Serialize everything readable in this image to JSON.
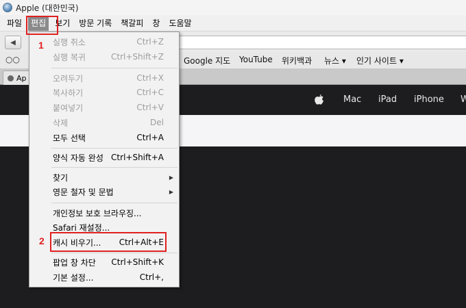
{
  "window": {
    "title": "Apple (대한민국)"
  },
  "menubar": {
    "items": [
      "파일",
      "편집",
      "보기",
      "방문 기록",
      "책갈피",
      "창",
      "도움말"
    ],
    "active": "편집"
  },
  "bookmarks": {
    "items": [
      "Google 지도",
      "YouTube",
      "위키백과",
      "뉴스 ▾",
      "인기 사이트 ▾"
    ]
  },
  "tab": {
    "label": "Ap"
  },
  "page": {
    "nav_links": [
      "Mac",
      "iPad",
      "iPhone",
      "W"
    ]
  },
  "annotations": {
    "step1": "1",
    "step2": "2",
    "color": "#e02020"
  },
  "edit_menu": {
    "undo": {
      "label": "실행 취소",
      "shortcut": "Ctrl+Z"
    },
    "redo": {
      "label": "실행 복귀",
      "shortcut": "Ctrl+Shift+Z"
    },
    "cut": {
      "label": "오려두기",
      "shortcut": "Ctrl+X"
    },
    "copy": {
      "label": "복사하기",
      "shortcut": "Ctrl+C"
    },
    "paste": {
      "label": "붙여넣기",
      "shortcut": "Ctrl+V"
    },
    "delete": {
      "label": "삭제",
      "shortcut": "Del"
    },
    "select_all": {
      "label": "모두 선택",
      "shortcut": "Ctrl+A"
    },
    "autofill": {
      "label": "양식 자동 완성",
      "shortcut": "Ctrl+Shift+A"
    },
    "find": {
      "label": "찾기"
    },
    "spelling": {
      "label": "영문 철자 및 문법"
    },
    "private": {
      "label": "개인정보 보호 브라우징..."
    },
    "reset": {
      "label": "Safari 재설정..."
    },
    "empty_cache": {
      "label": "캐시 비우기...",
      "shortcut": "Ctrl+Alt+E"
    },
    "block_popups": {
      "label": "팝업 창 차단",
      "shortcut": "Ctrl+Shift+K"
    },
    "preferences": {
      "label": "기본 설정...",
      "shortcut": "Ctrl+,"
    }
  }
}
